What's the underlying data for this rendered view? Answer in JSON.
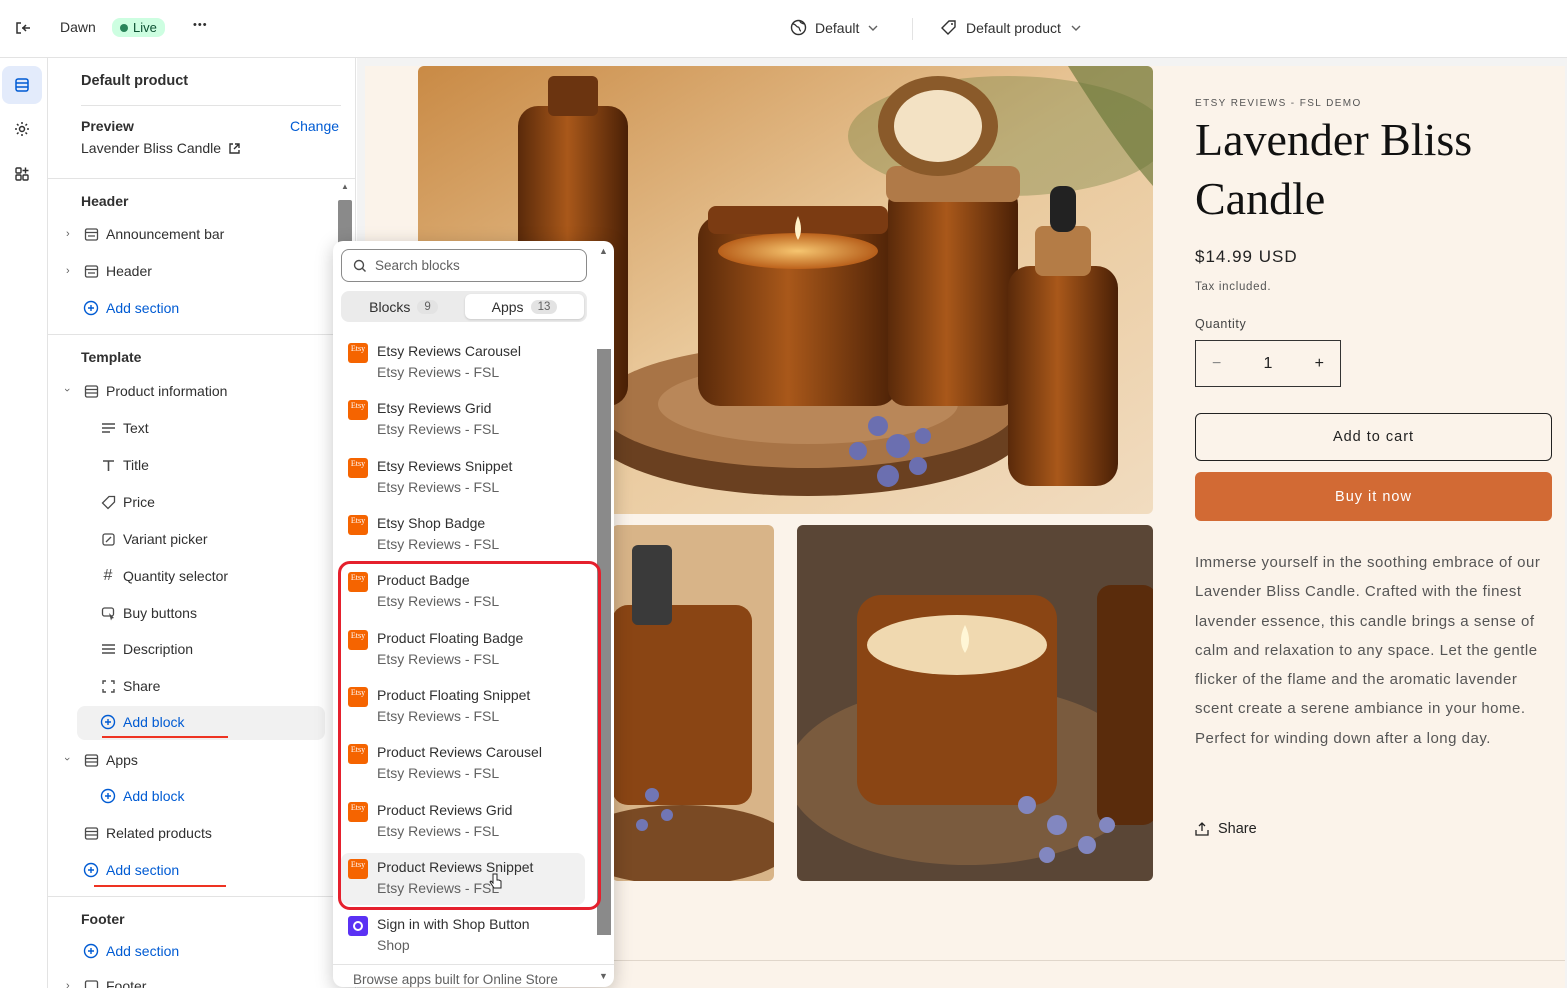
{
  "topbar": {
    "theme_name": "Dawn",
    "live_label": "Live",
    "more_label": "•••",
    "market_label": "Default",
    "template_label": "Default product"
  },
  "sidebar": {
    "title": "Default product",
    "preview_label": "Preview",
    "change_label": "Change",
    "preview_product": "Lavender Bliss Candle",
    "header_group": "Header",
    "header_items": [
      "Announcement bar",
      "Header"
    ],
    "add_section": "Add section",
    "template_group": "Template",
    "product_information": "Product information",
    "blocks": [
      "Text",
      "Title",
      "Price",
      "Variant picker",
      "Quantity selector",
      "Buy buttons",
      "Description",
      "Share"
    ],
    "add_block": "Add block",
    "apps_label": "Apps",
    "related_products": "Related products",
    "footer_group": "Footer",
    "footer_item": "Footer"
  },
  "popup": {
    "search_placeholder": "Search blocks",
    "tab_blocks": "Blocks",
    "tab_blocks_count": "9",
    "tab_apps": "Apps",
    "tab_apps_count": "13",
    "icon_text": "Etsy",
    "items": [
      {
        "name": "Etsy Reviews Carousel",
        "sub": "Etsy Reviews - FSL"
      },
      {
        "name": "Etsy Reviews Grid",
        "sub": "Etsy Reviews - FSL"
      },
      {
        "name": "Etsy Reviews Snippet",
        "sub": "Etsy Reviews - FSL"
      },
      {
        "name": "Etsy Shop Badge",
        "sub": "Etsy Reviews - FSL"
      },
      {
        "name": "Product Badge",
        "sub": "Etsy Reviews - FSL"
      },
      {
        "name": "Product Floating Badge",
        "sub": "Etsy Reviews - FSL"
      },
      {
        "name": "Product Floating Snippet",
        "sub": "Etsy Reviews - FSL"
      },
      {
        "name": "Product Reviews Carousel",
        "sub": "Etsy Reviews - FSL"
      },
      {
        "name": "Product Reviews Grid",
        "sub": "Etsy Reviews - FSL"
      },
      {
        "name": "Product Reviews Snippet",
        "sub": "Etsy Reviews - FSL"
      },
      {
        "name": "Sign in with Shop Button",
        "sub": "Shop"
      }
    ],
    "browse": "Browse apps built for Online Store"
  },
  "product": {
    "vendor": "ETSY REVIEWS - FSL DEMO",
    "title": "Lavender Bliss Candle",
    "price": "$14.99 USD",
    "tax": "Tax included.",
    "quantity_label": "Quantity",
    "quantity": "1",
    "minus": "−",
    "plus": "+",
    "add_to_cart": "Add to cart",
    "buy_now": "Buy it now",
    "description": "Immerse yourself in the soothing embrace of our Lavender Bliss Candle. Crafted with the finest lavender essence, this candle brings a sense of calm and relaxation to any space. Let the gentle flicker of the flame and the aromatic lavender scent create a serene ambiance in your home. Perfect for winding down after a long day.",
    "share": "Share"
  },
  "colors": {
    "accent_blue": "#005bd3",
    "buy_button": "#d26a34",
    "annotation_red": "#e5202d",
    "live_green": "#29845a"
  }
}
